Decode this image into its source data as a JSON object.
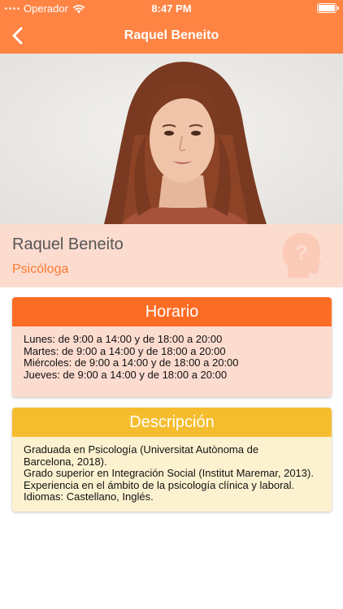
{
  "status_bar": {
    "carrier": "Operador",
    "time": "8:47 PM"
  },
  "nav": {
    "title": "Raquel Beneito",
    "back_icon": "chevron-left-icon"
  },
  "profile": {
    "name": "Raquel Beneito",
    "role": "Psicóloga",
    "icon": "head-question-icon"
  },
  "horario": {
    "title": "Horario",
    "lines": [
      "Lunes: de 9:00 a 14:00 y de 18:00 a 20:00",
      "Martes: de 9:00 a 14:00 y de 18:00 a 20:00",
      "Miércoles: de 9:00 a 14:00 y de 18:00 a 20:00",
      "Jueves: de 9:00 a 14:00 y de 18:00 a 20:00"
    ]
  },
  "descripcion": {
    "title": "Descripción",
    "lines": [
      "Graduada en Psicología (Universitat Autònoma de",
      "Barcelona, 2018).",
      "Grado superior en Integración Social (Institut Maremar, 2013).",
      "Experiencia en el ámbito de la psicología clínica y laboral.",
      "Idiomas: Castellano, Inglés."
    ]
  },
  "colors": {
    "nav_bar": "#fe8444",
    "name_band": "#fddcd0",
    "role_text": "#fa7a30",
    "horario_header": "#fd6c25",
    "horario_body": "#fddcd0",
    "descripcion_header": "#f5bd2e",
    "descripcion_body": "#fdf2d0"
  }
}
